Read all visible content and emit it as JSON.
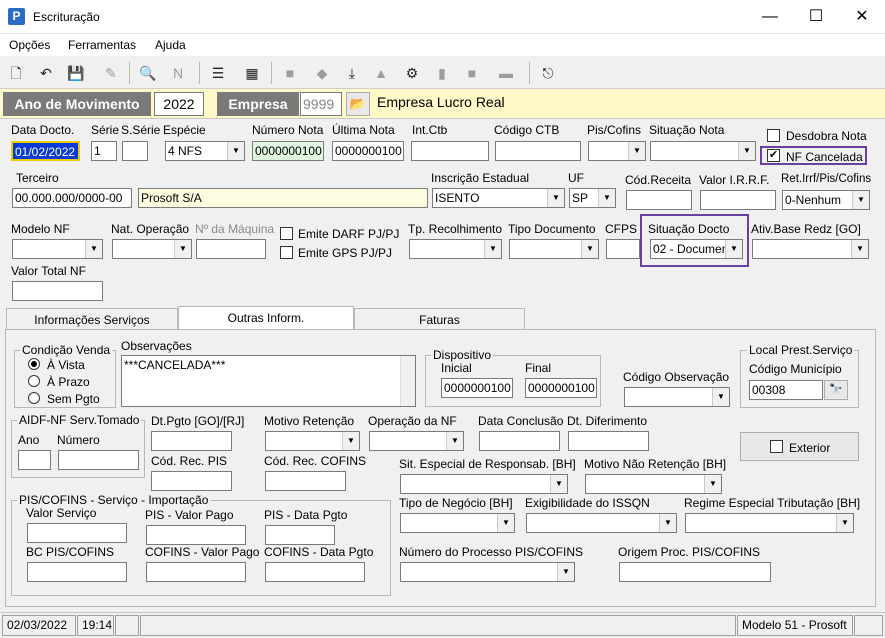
{
  "window": {
    "title": "Escrituração",
    "minimize": "—",
    "maximize": "☐",
    "close": "✕"
  },
  "menu": [
    "Opções",
    "Ferramentas",
    "Ajuda"
  ],
  "yearbar": {
    "ano_label": "Ano de Movimento",
    "ano_value": "2022",
    "empresa_label": "Empresa",
    "empresa_code": "9999",
    "empresa_name": "Empresa Lucro Real"
  },
  "row1": {
    "data_docto_label": "Data Docto.",
    "data_docto_value": "01/02/2022",
    "serie_label": "Série",
    "serie_value": "1",
    "sserie_label": "S.Série",
    "sserie_value": "",
    "especie_label": "Espécie",
    "especie_value": "4 NFS",
    "numero_label": "Número Nota",
    "numero_value": "0000000100",
    "ultima_label": "Última Nota",
    "ultima_value": "0000000100",
    "intctb_label": "Int.Ctb",
    "codctb_label": "Código CTB",
    "piscofins_label": "Pis/Cofins",
    "situacao_nota_label": "Situação Nota",
    "desdobra_label": "Desdobra Nota",
    "nf_cancelada_label": "NF Cancelada",
    "nf_cancelada_checked": "✔"
  },
  "row2": {
    "terceiro_label": "Terceiro",
    "terceiro_cnpj": "00.000.000/0000-00",
    "terceiro_nome": "Prosoft S/A",
    "ie_label": "Inscrição Estadual",
    "ie_value": "ISENTO",
    "uf_label": "UF",
    "uf_value": "SP",
    "codreceita_label": "Cód.Receita",
    "irrf_label": "Valor I.R.R.F.",
    "retirrf_label": "Ret.Irrf/Pis/Cofins",
    "retirrf_value": "0-Nenhum"
  },
  "row3": {
    "modelo_label": "Modelo NF",
    "natop_label": "Nat. Operação",
    "nmaquina_label": "Nº da Máquina",
    "darf_label": "Emite DARF PJ/PJ",
    "gps_label": "Emite GPS PJ/PJ",
    "tprec_label": "Tp. Recolhimento",
    "tpdoc_label": "Tipo Documento",
    "cfps_label": "CFPS",
    "situacao_docto_label": "Situação Docto",
    "situacao_docto_value": "02 - Documen",
    "ativbase_label": "Ativ.Base Redz [GO]"
  },
  "row4": {
    "valor_total_label": "Valor Total NF"
  },
  "tabs": [
    "Informações Serviços",
    "Outras Inform.",
    "Faturas"
  ],
  "panel": {
    "condicao_title": "Condição Venda",
    "condicao_options": [
      "À Vista",
      "À Prazo",
      "Sem Pgto"
    ],
    "obs_label": "Observações",
    "obs_value": "***CANCELADA***",
    "dispositivo_title": "Dispositivo",
    "disp_inicial_label": "Inicial",
    "disp_inicial_value": "0000000100",
    "disp_final_label": "Final",
    "disp_final_value": "0000000100",
    "codobs_label": "Código Observação",
    "local_title": "Local Prest.Serviço",
    "codmun_label": "Código Município",
    "codmun_value": "00308",
    "aidf_title": "AIDF-NF Serv.Tomado",
    "aidf_ano_label": "Ano",
    "aidf_numero_label": "Número",
    "dtpgto_label": "Dt.Pgto [GO]/[RJ]",
    "motivo_ret_label": "Motivo Retenção",
    "operacao_label": "Operação da NF",
    "dataconc_label": "Data Conclusão",
    "dtdif_label": "Dt. Diferimento",
    "exterior_label": "Exterior",
    "codrecpis_label": "Cód. Rec. PIS",
    "codreccofins_label": "Cód. Rec. COFINS",
    "sitesp_label": "Sit. Especial de Responsab. [BH]",
    "motivonaoret_label": "Motivo Não Retenção [BH]",
    "pisimp_title": "PIS/COFINS - Serviço - Importação",
    "valorserv_label": "Valor Serviço",
    "pisvalor_label": "PIS - Valor Pago",
    "pisdata_label": "PIS - Data Pgto",
    "bcpis_label": "BC PIS/COFINS",
    "cofinsvalor_label": "COFINS - Valor Pago",
    "cofinsdata_label": "COFINS - Data Pgto",
    "tiponeg_label": "Tipo de Negócio [BH]",
    "exig_label": "Exigibilidade do ISSQN",
    "regime_label": "Regime Especial Tributação [BH]",
    "numproc_label": "Número do Processo PIS/COFINS",
    "origem_label": "Origem Proc. PIS/COFINS"
  },
  "status": {
    "date": "02/03/2022",
    "time": "19:14",
    "version": "Modelo 51 - Prosoft"
  },
  "colors": {
    "highlight": "#6b3fa0",
    "yearbar": "#fff8c8",
    "label_dark": "#7a7a7a",
    "date_selected": "#0a3ad6"
  }
}
